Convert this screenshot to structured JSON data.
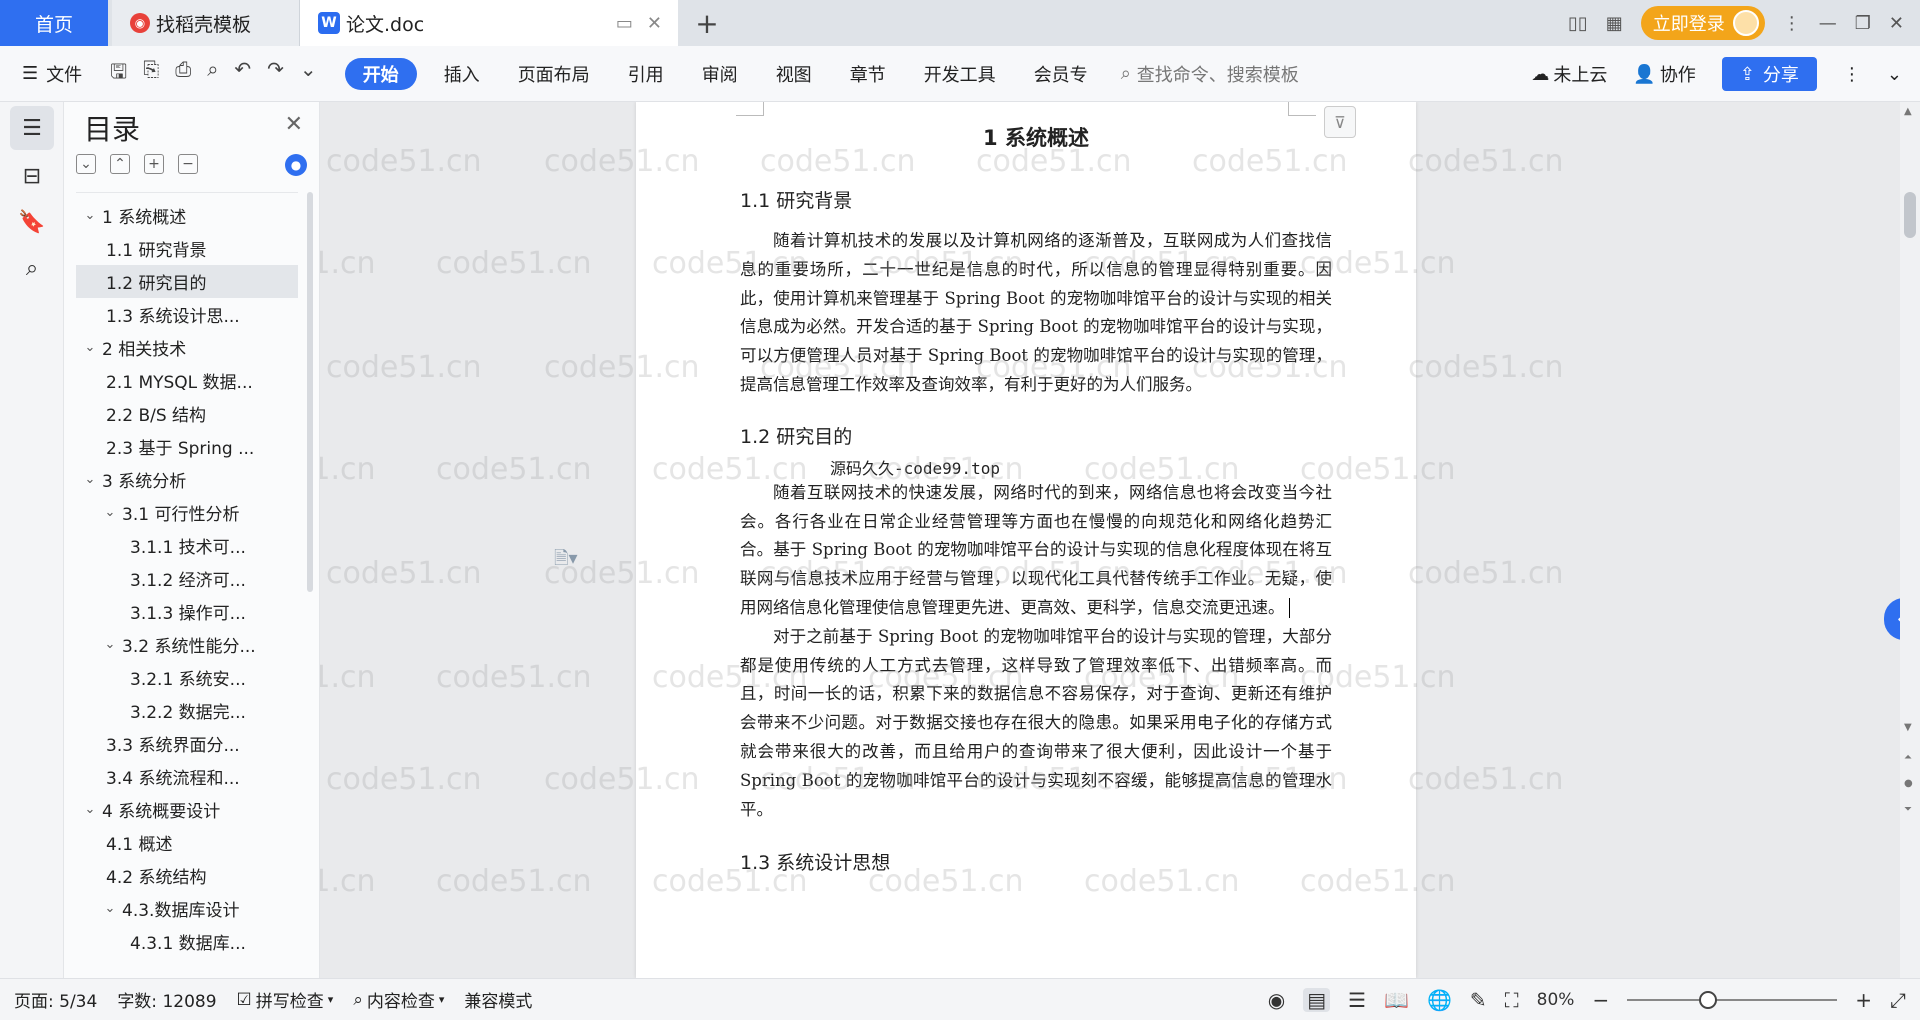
{
  "tabs": {
    "home": "首页",
    "templates": "找稻壳模板",
    "document": "论文.doc"
  },
  "topbar": {
    "login": "立即登录"
  },
  "menubar": {
    "file": "文件",
    "items": [
      "开始",
      "插入",
      "页面布局",
      "引用",
      "审阅",
      "视图",
      "章节",
      "开发工具",
      "会员专"
    ],
    "search_placeholder": "查找命令、搜索模板",
    "cloud": "未上云",
    "collab": "协作",
    "share": "分享"
  },
  "toc": {
    "title": "目录",
    "items": [
      {
        "level": "l1",
        "label": "1 系统概述",
        "expanded": true
      },
      {
        "level": "l2",
        "label": "1.1  研究背景"
      },
      {
        "level": "l2",
        "label": "1.2 研究目的",
        "selected": true
      },
      {
        "level": "l2",
        "label": "1.3 系统设计思..."
      },
      {
        "level": "l1",
        "label": "2 相关技术",
        "expanded": true
      },
      {
        "level": "l2",
        "label": "2.1 MYSQL 数据..."
      },
      {
        "level": "l2",
        "label": "2.2 B/S 结构"
      },
      {
        "level": "l2",
        "label": "2.3  基于 Spring ..."
      },
      {
        "level": "l1",
        "label": "3 系统分析",
        "expanded": true
      },
      {
        "level": "l2c",
        "label": "3.1 可行性分析",
        "expanded": true
      },
      {
        "level": "l3",
        "label": "3.1.1 技术可..."
      },
      {
        "level": "l3",
        "label": "3.1.2 经济可..."
      },
      {
        "level": "l3",
        "label": "3.1.3 操作可..."
      },
      {
        "level": "l2c",
        "label": "3.2 系统性能分...",
        "expanded": true
      },
      {
        "level": "l3",
        "label": "3.2.1  系统安..."
      },
      {
        "level": "l3",
        "label": "3.2.2  数据完..."
      },
      {
        "level": "l2",
        "label": "3.3 系统界面分..."
      },
      {
        "level": "l2",
        "label": "3.4 系统流程和..."
      },
      {
        "level": "l1",
        "label": "4 系统概要设计",
        "expanded": true
      },
      {
        "level": "l2",
        "label": "4.1 概述"
      },
      {
        "level": "l2",
        "label": "4.2 系统结构"
      },
      {
        "level": "l2c",
        "label": "4.3.数据库设计",
        "expanded": true
      },
      {
        "level": "l3",
        "label": "4.3.1 数据库..."
      }
    ]
  },
  "document": {
    "h1": "1 系统概述",
    "s11_title": "1.1  研究背景",
    "s11_p1": "随着计算机技术的发展以及计算机网络的逐渐普及，互联网成为人们查找信息的重要场所，二十一世纪是信息的时代，所以信息的管理显得特别重要。因此，使用计算机来管理基于 Spring Boot 的宠物咖啡馆平台的设计与实现的相关信息成为必然。开发合适的基于 Spring  Boot 的宠物咖啡馆平台的设计与实现，可以方便管理人员对基于 Spring Boot 的宠物咖啡馆平台的设计与实现的管理，提高信息管理工作效率及查询效率，有利于更好的为人们服务。",
    "s12_title": "1.2 研究目的",
    "source_line": "源码久久-code99.top",
    "s12_p1": "随着互联网技术的快速发展，网络时代的到来，网络信息也将会改变当今社会。各行各业在日常企业经营管理等方面也在慢慢的向规范化和网络化趋势汇合。基于 Spring Boot 的宠物咖啡馆平台的设计与实现的信息化程度体现在将互联网与信息技术应用于经营与管理，以现代化工具代替传统手工作业。无疑，使用网络信息化管理使信息管理更先进、更高效、更科学，信息交流更迅速。",
    "s12_p2": "对于之前基于 Spring Boot 的宠物咖啡馆平台的设计与实现的管理，大部分都是使用传统的人工方式去管理，这样导致了管理效率低下、出错频率高。而且，时间一长的话，积累下来的数据信息不容易保存，对于查询、更新还有维护会带来不少问题。对于数据交接也存在很大的隐患。如果采用电子化的存储方式就会带来很大的改善，而且给用户的查询带来了很大便利，因此设计一个基于 Spring Boot 的宠物咖啡馆平台的设计与实现刻不容缓，能够提高信息的管理水平。",
    "s13_title": "1.3 系统设计思想"
  },
  "watermark": "code51.cn",
  "statusbar": {
    "page": "页面: 5/34",
    "words": "字数: 12089",
    "spellcheck": "拼写检查",
    "content_check": "内容检查",
    "compat": "兼容模式",
    "zoom": "80%"
  },
  "colors": {
    "accent": "#2f6ff0",
    "login": "#f3a51a"
  }
}
